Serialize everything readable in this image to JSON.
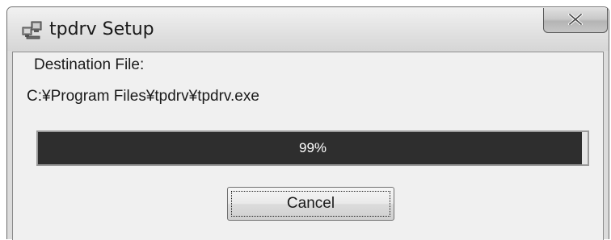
{
  "window": {
    "title": "tpdrv Setup",
    "icon": "setup-computer-icon",
    "close_glyph": "X"
  },
  "dialog": {
    "destination_label": "Destination File:",
    "destination_path": "C:¥Program Files¥tpdrv¥tpdrv.exe"
  },
  "progress": {
    "percent_text": "99%",
    "value": 0.99
  },
  "buttons": {
    "cancel_label": "Cancel"
  },
  "colors": {
    "progress_fill": "#2e2e2e",
    "progress_text": "#ffffff",
    "client_background": "#f0f0f0"
  }
}
